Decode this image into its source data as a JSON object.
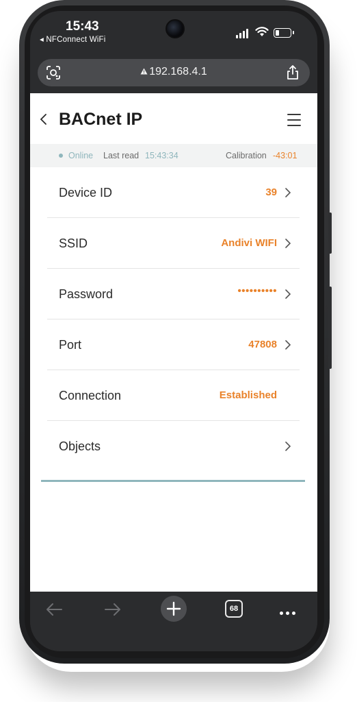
{
  "status_bar": {
    "time": "15:43",
    "carrier": "◂ NFConnect WiFi"
  },
  "browser": {
    "url": "192.168.4.1",
    "url_icon": "warning-triangle-icon",
    "tab_count": "68"
  },
  "header": {
    "title": "BACnet IP"
  },
  "info_bar": {
    "status": "Online",
    "last_read_label": "Last read",
    "last_read_value": "15:43:34",
    "calibration_label": "Calibration",
    "calibration_value": "-43:01"
  },
  "settings": [
    {
      "label": "Device ID",
      "value": "39"
    },
    {
      "label": "SSID",
      "value": "Andivi WIFI"
    },
    {
      "label": "Password",
      "value": "••••••••••"
    },
    {
      "label": "Port",
      "value": "47808"
    },
    {
      "label": "Connection",
      "value": "Established"
    },
    {
      "label": "Objects",
      "value": ""
    }
  ],
  "colors": {
    "accent_orange": "#e9822a",
    "accent_teal": "#8fb6bc",
    "device_frame": "#2b2c2e"
  }
}
